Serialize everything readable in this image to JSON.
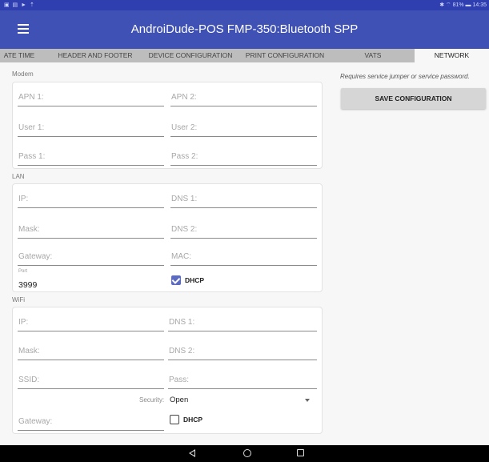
{
  "status_bar": {
    "left_icons": "▣ ▤ ► ⇡",
    "right": "✱ ⌔ 81% ▬ 14:35"
  },
  "app_bar": {
    "title": "AndroiDude-POS   FMP-350:Bluetooth SPP"
  },
  "tabs": [
    {
      "label": "ATE TIME",
      "active": false
    },
    {
      "label": "HEADER AND FOOTER",
      "active": false
    },
    {
      "label": "DEVICE CONFIGURATION",
      "active": false
    },
    {
      "label": "PRINT CONFIGURATION",
      "active": false
    },
    {
      "label": "VATS",
      "active": false
    },
    {
      "label": "NETWORK",
      "active": true
    }
  ],
  "modem": {
    "label": "Modem",
    "apn1": "APN 1:",
    "apn2": "APN 2:",
    "user1": "User 1:",
    "user2": "User 2:",
    "pass1": "Pass 1:",
    "pass2": "Pass 2:"
  },
  "lan": {
    "label": "LAN",
    "ip": "IP:",
    "dns1": "DNS 1:",
    "mask": "Mask:",
    "dns2": "DNS 2:",
    "gateway": "Gateway:",
    "mac": "MAC:",
    "port_label": "Port",
    "port_value": "3999",
    "dhcp_label": "DHCP",
    "dhcp_checked": true
  },
  "wifi": {
    "label": "WiFi",
    "ip": "IP:",
    "dns1": "DNS 1:",
    "mask": "Mask:",
    "dns2": "DNS 2:",
    "ssid": "SSID:",
    "pass": "Pass:",
    "security_label": "Security:",
    "security_value": "Open",
    "gateway": "Gateway:",
    "dhcp_label": "DHCP",
    "dhcp_checked": false
  },
  "side": {
    "note": "Requires service jumper or service password.",
    "save_label": "SAVE CONFIGURATION"
  },
  "icons": {
    "menu": "hamburger-menu-icon",
    "back": "nav-back-icon",
    "home": "nav-home-icon",
    "recent": "nav-recent-apps-icon",
    "check": "checkbox-icon",
    "dropdown": "dropdown-arrow-icon"
  },
  "colors": {
    "app_bar": "#3f51b5",
    "status_bar": "#2f3fb0",
    "tab_strip": "#bdbdbd",
    "checkbox": "#5c6bc0"
  }
}
